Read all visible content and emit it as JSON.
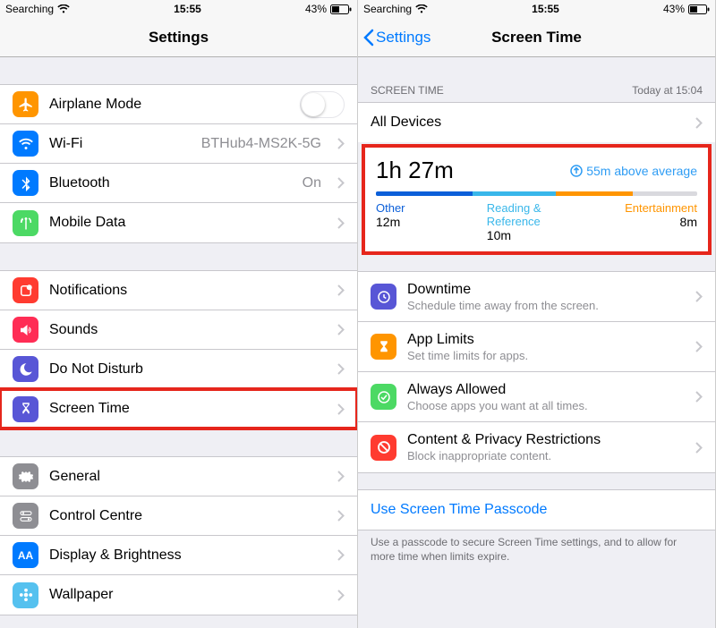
{
  "status": {
    "carrier": "Searching",
    "time": "15:55",
    "battery": "43%"
  },
  "left": {
    "title": "Settings",
    "groups": [
      {
        "rows": [
          {
            "icon": "airplane",
            "bg": "#ff9500",
            "label": "Airplane Mode",
            "type": "switch"
          },
          {
            "icon": "wifi",
            "bg": "#007aff",
            "label": "Wi-Fi",
            "detail": "BTHub4-MS2K-5G"
          },
          {
            "icon": "bluetooth",
            "bg": "#007aff",
            "label": "Bluetooth",
            "detail": "On"
          },
          {
            "icon": "antenna",
            "bg": "#4cd964",
            "label": "Mobile Data"
          }
        ]
      },
      {
        "rows": [
          {
            "icon": "bell",
            "bg": "#ff3b30",
            "label": "Notifications"
          },
          {
            "icon": "speaker",
            "bg": "#ff2d55",
            "label": "Sounds"
          },
          {
            "icon": "moon",
            "bg": "#5856d6",
            "label": "Do Not Disturb"
          },
          {
            "icon": "hourglass",
            "bg": "#5856d6",
            "label": "Screen Time",
            "highlight": true
          }
        ]
      },
      {
        "rows": [
          {
            "icon": "gear",
            "bg": "#8e8e93",
            "label": "General"
          },
          {
            "icon": "switches",
            "bg": "#8e8e93",
            "label": "Control Centre"
          },
          {
            "icon": "aa",
            "bg": "#007aff",
            "label": "Display & Brightness"
          },
          {
            "icon": "flower",
            "bg": "#55c1ef",
            "label": "Wallpaper"
          }
        ]
      }
    ]
  },
  "right": {
    "back": "Settings",
    "title": "Screen Time",
    "header": {
      "left": "SCREEN TIME",
      "right": "Today at 15:04"
    },
    "alldevices": "All Devices",
    "stats": {
      "total": "1h 27m",
      "avg": "55m above average",
      "cats": [
        {
          "label": "Other",
          "value": "12m",
          "color": "#0b5fd9",
          "w": 30
        },
        {
          "label": "Reading & Reference",
          "value": "10m",
          "color": "#39b7ea",
          "w": 26
        },
        {
          "label": "Entertainment",
          "value": "8m",
          "color": "#ff9500",
          "w": 24
        }
      ]
    },
    "options": [
      {
        "icon": "moon2",
        "bg": "#5856d6",
        "title": "Downtime",
        "sub": "Schedule time away from the screen."
      },
      {
        "icon": "hourglass",
        "bg": "#ff9500",
        "title": "App Limits",
        "sub": "Set time limits for apps."
      },
      {
        "icon": "check",
        "bg": "#4cd964",
        "title": "Always Allowed",
        "sub": "Choose apps you want at all times."
      },
      {
        "icon": "nocircle",
        "bg": "#ff3b30",
        "title": "Content & Privacy Restrictions",
        "sub": "Block inappropriate content."
      }
    ],
    "passcode": "Use Screen Time Passcode",
    "passcode_footer": "Use a passcode to secure Screen Time settings, and to allow for more time when limits expire."
  }
}
